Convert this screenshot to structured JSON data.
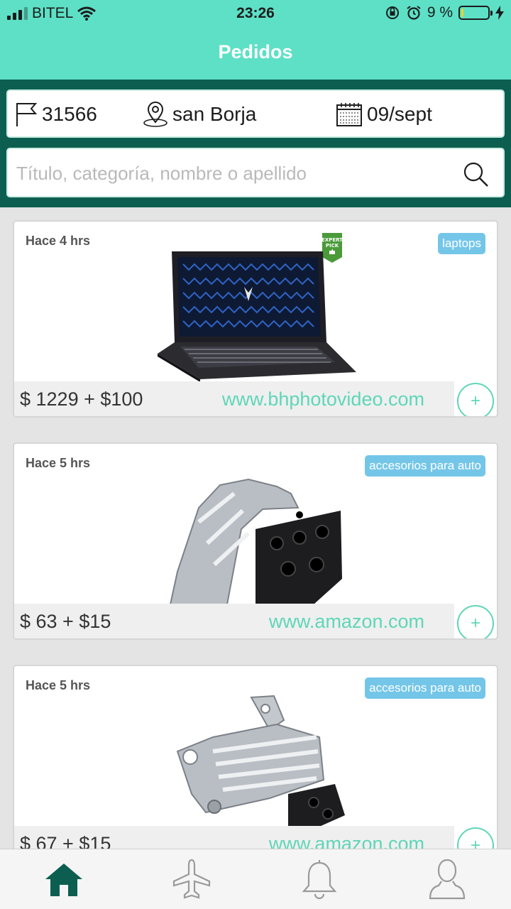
{
  "status_bar": {
    "carrier": "BITEL",
    "time": "23:26",
    "battery_percent": "9 %",
    "battery_level": 0.09
  },
  "header": {
    "title": "Pedidos"
  },
  "filters": {
    "order_id": "31566",
    "location": "san Borja",
    "date": "09/sept",
    "search_placeholder": "Título, categoría, nombre o apellido"
  },
  "orders": [
    {
      "time_ago": "Hace 4 hrs",
      "category": "laptops",
      "price": "$ 1229 + $100",
      "site": "www.bhphotovideo.com",
      "image": "laptop",
      "badge": "EXPERT PICK"
    },
    {
      "time_ago": "Hace 5 hrs",
      "category": "accesorios para auto",
      "price": "$ 63 + $15",
      "site": "www.amazon.com",
      "image": "engine-mount"
    },
    {
      "time_ago": "Hace 5 hrs",
      "category": "accesorios para auto",
      "price": "$ 67 + $15",
      "site": "www.amazon.com",
      "image": "engine-mount"
    }
  ],
  "add_label": "+",
  "tabs": [
    {
      "name": "home-icon",
      "active": true
    },
    {
      "name": "airplane-icon",
      "active": false
    },
    {
      "name": "bell-icon",
      "active": false
    },
    {
      "name": "user-icon",
      "active": false
    }
  ],
  "colors": {
    "accent": "#5de0c6",
    "dark": "#0c5f50",
    "link": "#5fd6b8",
    "badge": "#74c6e8"
  }
}
